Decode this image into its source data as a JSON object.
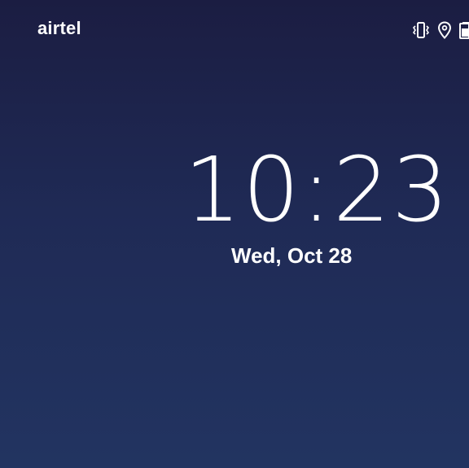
{
  "status_bar": {
    "carrier": "airtel",
    "icons": [
      "vibrate-icon",
      "location-icon",
      "battery-icon"
    ]
  },
  "lock_screen": {
    "time": "10:23",
    "date": "Wed, Oct 28"
  },
  "colors": {
    "background_top": "#1b1d42",
    "background_bottom": "#223461",
    "text": "#ffffff"
  }
}
